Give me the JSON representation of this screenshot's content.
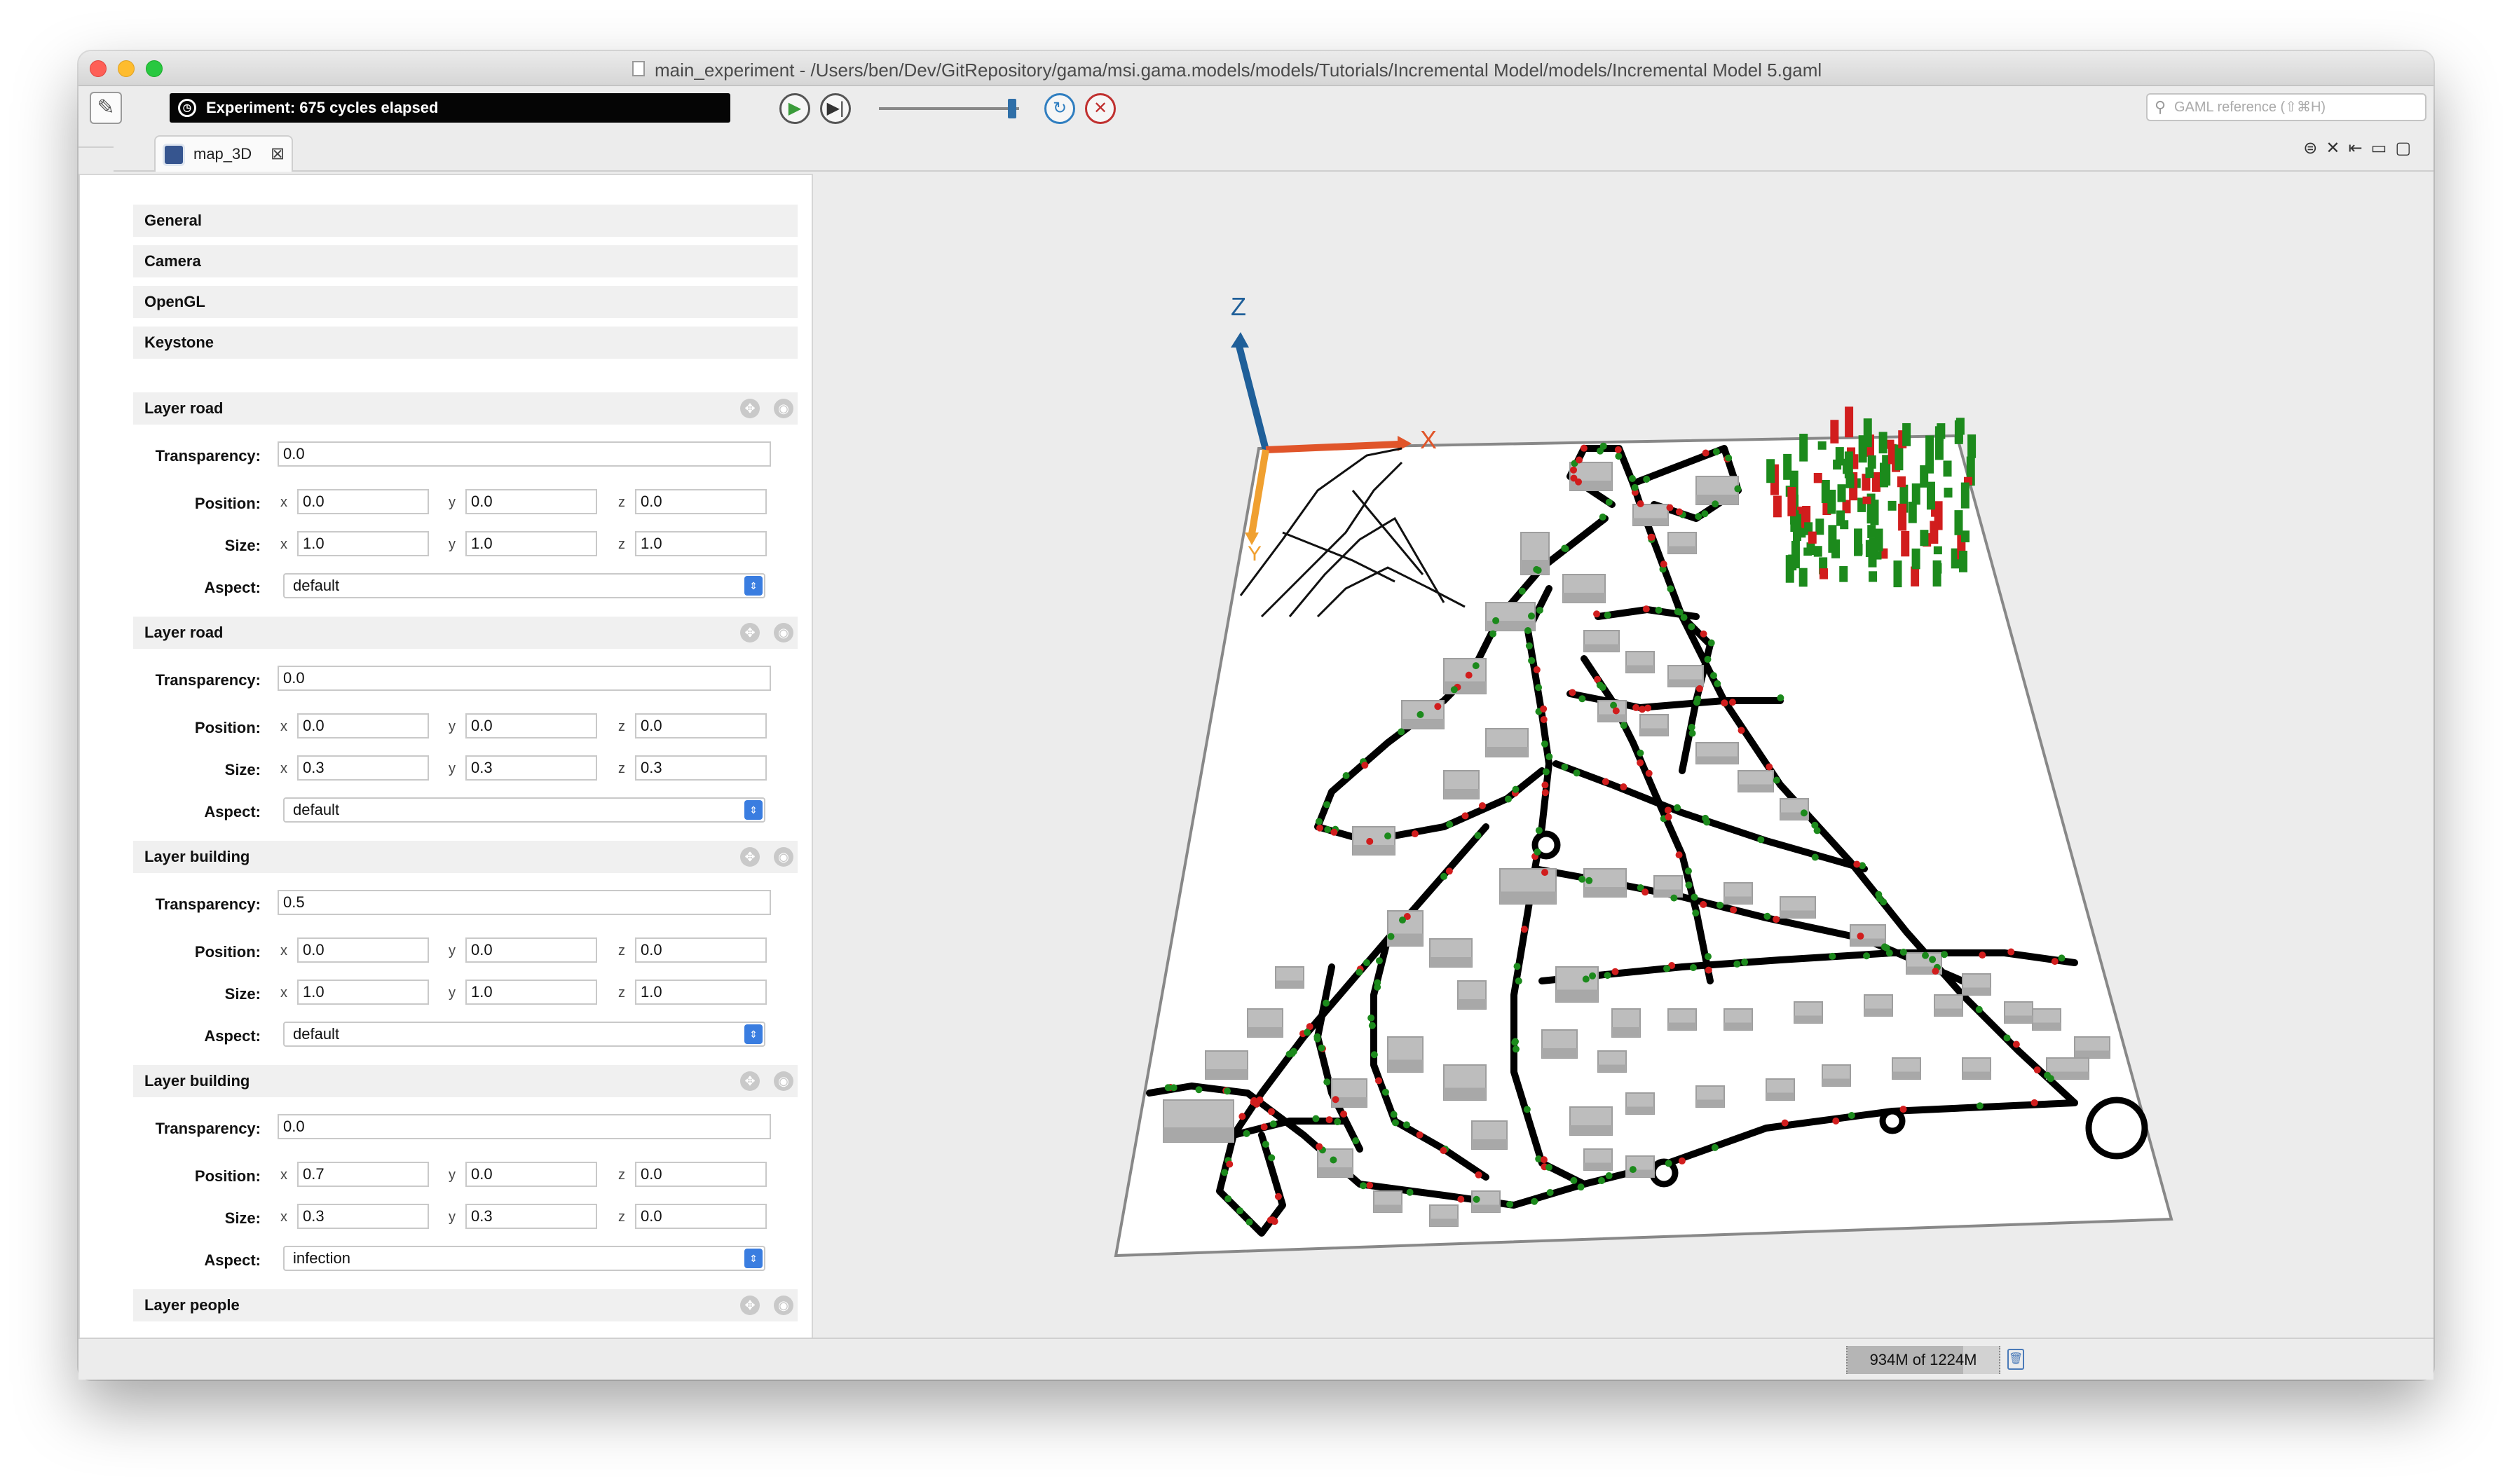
{
  "window": {
    "title": "main_experiment - /Users/ben/Dev/GitRepository/gama/msi.gama.models/models/Tutorials/Incremental Model/models/Incremental Model 5.gaml"
  },
  "toolbar": {
    "status_text": "Experiment: 675 cycles elapsed",
    "play_icon": "play-icon",
    "step_icon": "step-icon",
    "reload_icon": "reload-icon",
    "close_icon": "close-icon",
    "speed_fraction": 0.92,
    "search_placeholder": "GAML reference (⇧⌘H)"
  },
  "tab": {
    "label": "map_3D"
  },
  "sections": [
    "General",
    "Camera",
    "OpenGL",
    "Keystone"
  ],
  "labels": {
    "transparency": "Transparency:",
    "position": "Position:",
    "size": "Size:",
    "aspect": "Aspect:",
    "x": "x",
    "y": "y",
    "z": "z"
  },
  "layers": [
    {
      "name": "Layer road",
      "transparency": "0.0",
      "position": [
        "0.0",
        "0.0",
        "0.0"
      ],
      "size": [
        "1.0",
        "1.0",
        "1.0"
      ],
      "aspect": "default"
    },
    {
      "name": "Layer road",
      "transparency": "0.0",
      "position": [
        "0.0",
        "0.0",
        "0.0"
      ],
      "size": [
        "0.3",
        "0.3",
        "0.3"
      ],
      "aspect": "default"
    },
    {
      "name": "Layer building",
      "transparency": "0.5",
      "position": [
        "0.0",
        "0.0",
        "0.0"
      ],
      "size": [
        "1.0",
        "1.0",
        "1.0"
      ],
      "aspect": "default"
    },
    {
      "name": "Layer building",
      "transparency": "0.0",
      "position": [
        "0.7",
        "0.0",
        "0.0"
      ],
      "size": [
        "0.3",
        "0.3",
        "0.0"
      ],
      "aspect": "infection"
    }
  ],
  "last_layer": "Layer people",
  "view3d": {
    "axis_z": "Z",
    "axis_x": "X",
    "axis_y": "Y",
    "colors": {
      "z_axis": "#1f5f99",
      "x_axis": "#e0552a",
      "y_axis": "#f0a030",
      "road": "#000000",
      "building": "#bdbdbd",
      "infected": "#d11d1d",
      "healthy": "#1c8a1c"
    }
  },
  "status": {
    "memory": "934M of 1224M",
    "memory_fraction": 0.763
  }
}
